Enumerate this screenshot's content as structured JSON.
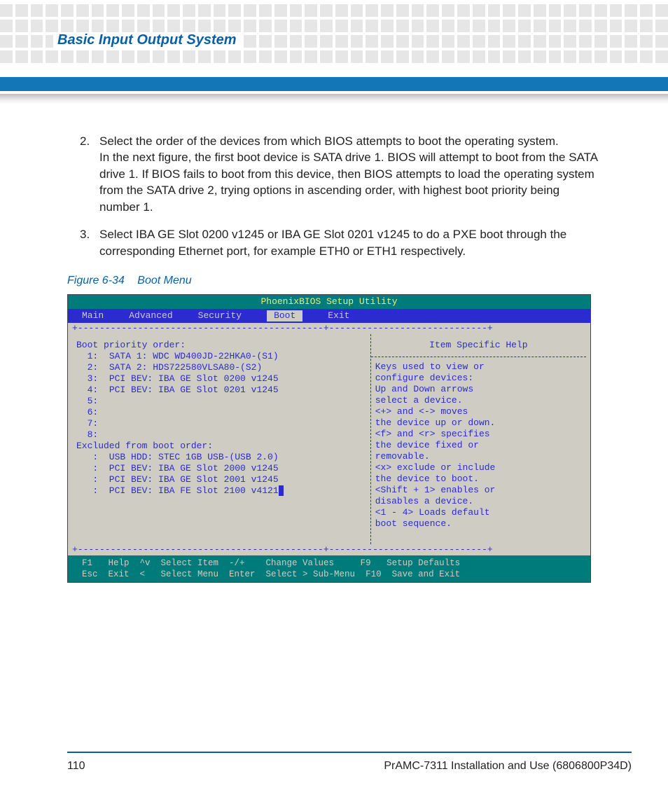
{
  "header": {
    "section_title": "Basic Input Output System"
  },
  "steps": [
    {
      "num": "2.",
      "text": "Select the order of the devices from which BIOS attempts to boot the operating system.\nIn the next figure, the first boot device is SATA drive 1. BIOS will attempt to boot from the SATA drive 1. If BIOS fails to boot from this device, then BIOS attempts to load the operating system from the SATA drive 2, trying options in ascending order, with highest boot priority being number 1."
    },
    {
      "num": "3.",
      "text": "Select IBA GE Slot 0200 v1245 or IBA GE Slot 0201 v1245 to do a PXE boot through the corresponding Ethernet port, for example ETH0 or ETH1 respectively."
    }
  ],
  "figure": {
    "number": "Figure 6-34",
    "title": "Boot Menu"
  },
  "bios": {
    "title": "PhoenixBIOS Setup Utility",
    "menu": [
      "Main",
      "Advanced",
      "Security",
      "Boot",
      "Exit"
    ],
    "active_menu": "Boot",
    "left_heading": "Boot priority order:",
    "priority": [
      "1:  SATA 1: WDC WD400JD-22HKA0-(S1)",
      "2:  SATA 2: HDS722580VLSA80-(S2)",
      "3:  PCI BEV: IBA GE Slot 0200 v1245",
      "4:  PCI BEV: IBA GE Slot 0201 v1245",
      "5:",
      "6:",
      "7:",
      "8:"
    ],
    "excluded_heading": "Excluded from boot order:",
    "excluded": [
      ":  USB HDD: STEC 1GB USB-(USB 2.0)",
      ":  PCI BEV: IBA GE Slot 2000 v1245",
      ":  PCI BEV: IBA GE Slot 2001 v1245",
      ":  PCI BEV: IBA FE Slot 2100 v4121"
    ],
    "help_title": "Item Specific Help",
    "help_lines": [
      "Keys used to view or",
      "configure devices:",
      "Up and Down arrows",
      "select a device.",
      "<+> and <-> moves",
      "the device up or down.",
      "<f> and <r> specifies",
      "the device fixed or",
      "removable.",
      "<x> exclude or include",
      "the device to boot.",
      "<Shift + 1> enables or",
      "disables a device.",
      "<1 - 4> Loads default",
      "boot sequence."
    ],
    "footer_line1": "F1   Help  ^v  Select Item  -/+    Change Values     F9   Setup Defaults",
    "footer_line2": "Esc  Exit  <   Select Menu  Enter  Select > Sub-Menu  F10  Save and Exit"
  },
  "footer": {
    "page": "110",
    "doc": "PrAMC-7311 Installation and Use (6806800P34D)"
  }
}
